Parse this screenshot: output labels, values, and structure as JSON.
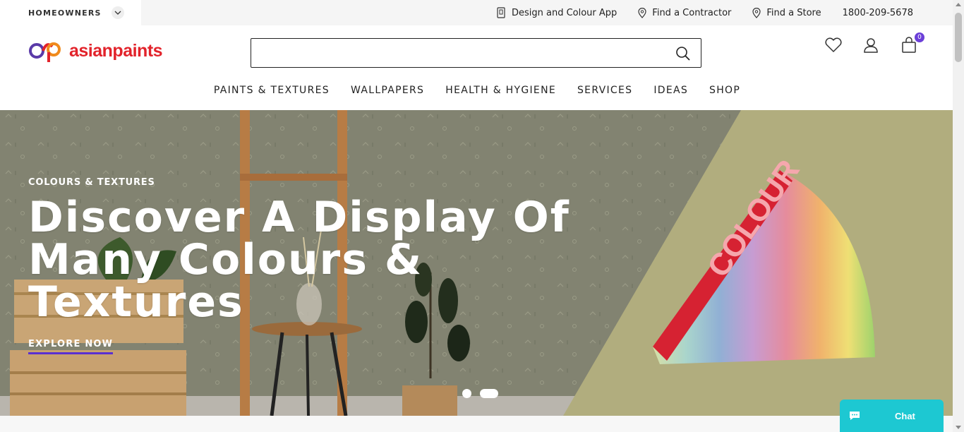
{
  "utility_bar": {
    "segment_label": "HOMEOWNERS",
    "links": [
      {
        "label": "Design and Colour App",
        "icon": "mobile-app-icon"
      },
      {
        "label": "Find a Contractor",
        "icon": "location-pin-icon"
      },
      {
        "label": "Find a Store",
        "icon": "location-pin-icon"
      }
    ],
    "phone": "1800-209-5678"
  },
  "header": {
    "logo_text": "asianpaints",
    "search_placeholder": "",
    "cart_count": "0"
  },
  "nav": {
    "items": [
      "PAINTS & TEXTURES",
      "WALLPAPERS",
      "HEALTH & HYGIENE",
      "SERVICES",
      "IDEAS",
      "SHOP"
    ]
  },
  "hero": {
    "eyebrow": "COLOURS & TEXTURES",
    "title": "Discover A Display Of Many Colours & Textures",
    "cta": "EXPLORE NOW",
    "product_text": "COLOUR",
    "slides_count": 2,
    "active_slide": 2
  },
  "chat": {
    "label": "Chat"
  },
  "colors": {
    "brand_red": "#e2232b",
    "accent_purple": "#5a2fd0",
    "chat_teal": "#1dc8d2"
  }
}
